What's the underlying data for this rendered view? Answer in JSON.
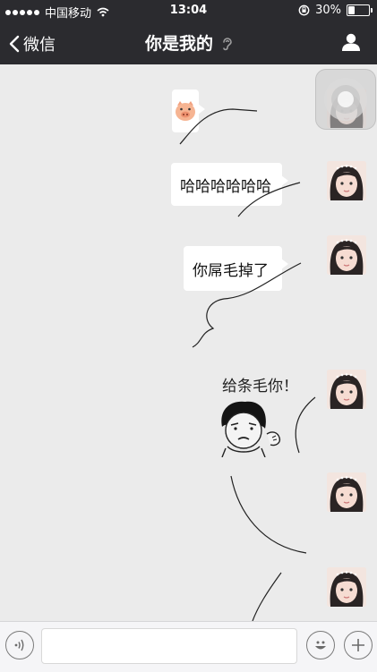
{
  "status_bar": {
    "carrier": "中国移动",
    "time": "13:04",
    "battery": "30%",
    "battery_level": 0.3,
    "signal_dots": 5,
    "icons": [
      "signal-dots-icon",
      "wifi-icon",
      "rotation-lock-icon",
      "battery-icon"
    ]
  },
  "header": {
    "back_label": "微信",
    "title": "你是我的",
    "title_icon": "ear-icon",
    "profile_icon": "person-icon",
    "bg_color": "#2b2b2f"
  },
  "messages": [
    {
      "id": "m1",
      "type": "emoji",
      "icon": "pig-face-icon",
      "sender": "self"
    },
    {
      "id": "m2",
      "type": "text",
      "text": "哈哈哈哈哈哈",
      "sender": "self"
    },
    {
      "id": "m3",
      "type": "text",
      "text": "你屌毛掉了",
      "sender": "self"
    },
    {
      "id": "m4",
      "type": "sticker",
      "caption": "给条毛你！",
      "icon": "meme-face-sticker",
      "sender": "self"
    },
    {
      "id": "m5",
      "type": "avatar-only",
      "sender": "self"
    },
    {
      "id": "m6",
      "type": "avatar-only",
      "sender": "self"
    }
  ],
  "input_bar": {
    "voice_icon": "voice-icon",
    "text_value": "",
    "emoji_icon": "smiley-icon",
    "more_icon": "plus-icon"
  },
  "colors": {
    "chat_bg": "#ebebeb",
    "bubble_bg": "#ffffff",
    "bar_bg": "#f5f5f7"
  }
}
